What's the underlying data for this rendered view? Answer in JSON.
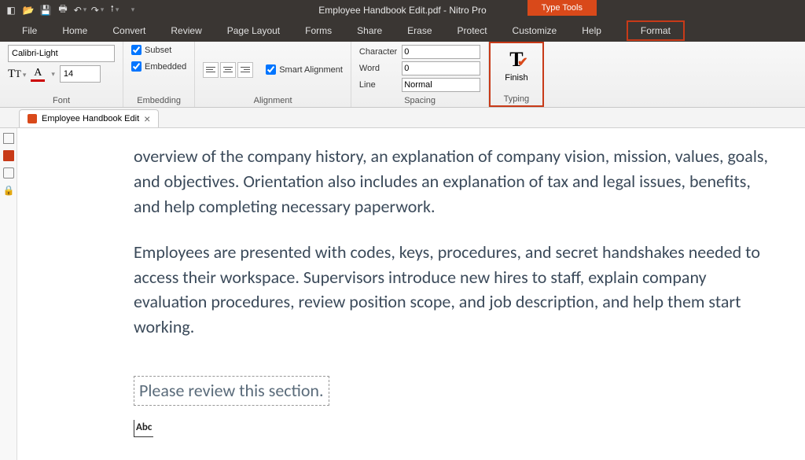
{
  "app": {
    "title": "Employee Handbook Edit.pdf - Nitro Pro",
    "type_tools_label": "Type Tools"
  },
  "menu": {
    "file": "File",
    "home": "Home",
    "convert": "Convert",
    "review": "Review",
    "page_layout": "Page Layout",
    "forms": "Forms",
    "share": "Share",
    "erase": "Erase",
    "protect": "Protect",
    "customize": "Customize",
    "help": "Help",
    "format": "Format"
  },
  "ribbon": {
    "font": {
      "label": "Font",
      "family": "Calibri-Light",
      "size": "14"
    },
    "embedding": {
      "label": "Embedding",
      "subset": "Subset",
      "embedded": "Embedded"
    },
    "alignment": {
      "label": "Alignment",
      "smart": "Smart Alignment"
    },
    "spacing": {
      "label": "Spacing",
      "character_label": "Character",
      "character_value": "0",
      "word_label": "Word",
      "word_value": "0",
      "line_label": "Line",
      "line_value": "Normal"
    },
    "typing": {
      "label": "Typing",
      "finish": "Finish"
    }
  },
  "tab": {
    "name": "Employee Handbook Edit"
  },
  "document": {
    "p1": "overview of the company history, an explanation of company vision, mission, values, goals, and objectives. Orientation also includes an explanation of tax and legal issues, benefits, and help completing necessary paperwork.",
    "p2": "Employees are presented with codes, keys, procedures, and secret handshakes needed to access their workspace. Supervisors introduce new hires to staff, explain company evaluation procedures, review position scope, and job description, and help them start working.",
    "edit_text": "Please review this section.",
    "abc": "Abc"
  }
}
